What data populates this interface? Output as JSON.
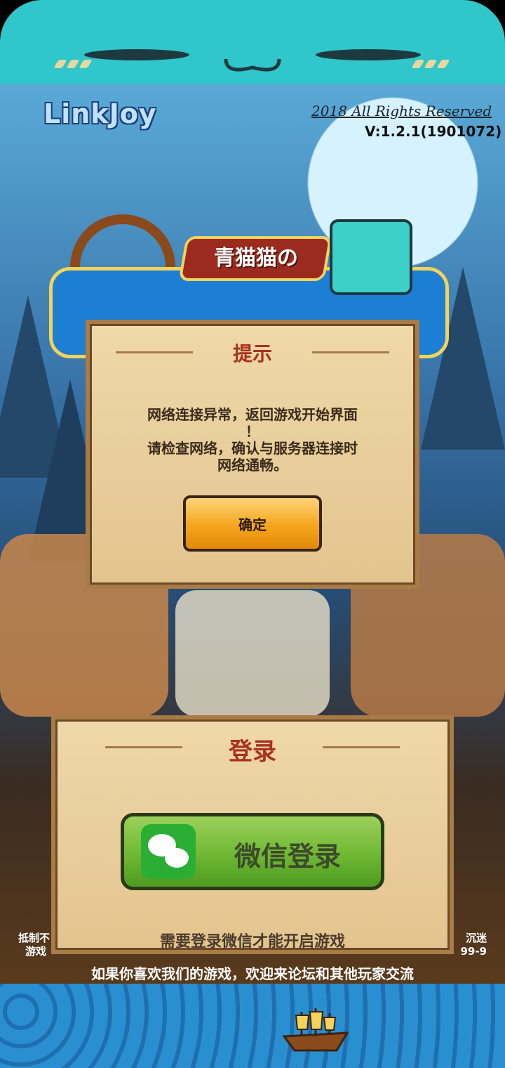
{
  "header": {
    "brand": "LinkJoy",
    "rights": "2018 All Rights Reserved",
    "version": "V:1.2.1(1901072)"
  },
  "game_title": {
    "subtitle": "青猫猫の"
  },
  "alert_dialog": {
    "title": "提示",
    "message_line1": "网络连接异常，返回游戏开始界面",
    "message_line2": "！",
    "message_line3": "请检查网络，确认与服务器连接时",
    "message_line4": "网络通畅。",
    "confirm_label": "确定"
  },
  "login_dialog": {
    "title": "登录",
    "wechat_button_label": "微信登录",
    "hint": "需要登录微信才能开启游戏"
  },
  "footer": {
    "left_line1": "抵制不",
    "left_line2": "游戏",
    "right_line1": "沉迷",
    "right_line2": "99-9",
    "forum_text": "如果你喜欢我们的游戏，欢迎来论坛和其他玩家交流"
  },
  "colors": {
    "accent_title": "#a8321e",
    "cat_teal": "#2fc7c9",
    "confirm_orange": "#f5a51c",
    "wechat_green": "#6fb834"
  }
}
